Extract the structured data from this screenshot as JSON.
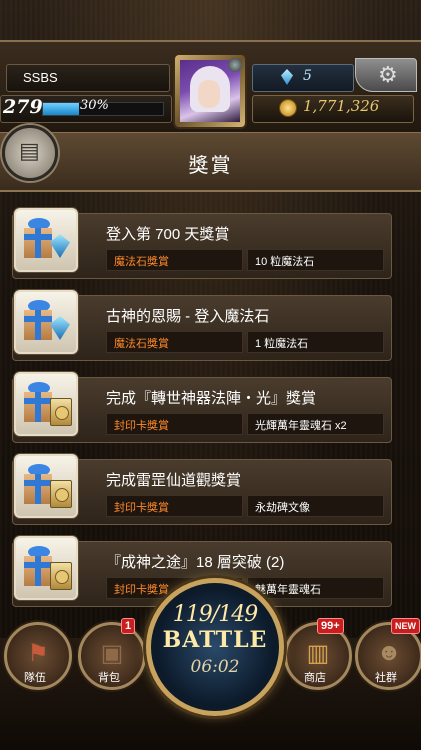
{
  "player": {
    "name": "SSBS",
    "level": "279",
    "xp_percent": "30%",
    "xp_fraction": 0.3
  },
  "currency": {
    "magic_stones": "5",
    "coins": "1,771,326"
  },
  "header": {
    "title": "獎賞"
  },
  "rewards": [
    {
      "title": "登入第 700 天獎賞",
      "type": "魔法石獎賞",
      "item": "10 粒魔法石",
      "icon": "gift-with-magic-stone-icon"
    },
    {
      "title": "古神的恩賜 - 登入魔法石",
      "type": "魔法石獎賞",
      "item": "1 粒魔法石",
      "icon": "gift-with-magic-stone-icon"
    },
    {
      "title": "完成『轉世神器法陣‧光』獎賞",
      "type": "封印卡獎賞",
      "item": "光輝萬年靈魂石 x2",
      "icon": "gift-with-seal-card-icon"
    },
    {
      "title": "完成雷罡仙道觀獎賞",
      "type": "封印卡獎賞",
      "item": "永劫碑文像",
      "icon": "gift-with-seal-card-icon"
    },
    {
      "title": "『成神之途』18 層突破 (2)",
      "type": "封印卡獎賞",
      "item": "魅萬年靈魂石",
      "icon": "gift-with-seal-card-icon"
    }
  ],
  "nav": {
    "team": {
      "label": "隊伍"
    },
    "bag": {
      "label": "背包",
      "badge": "1"
    },
    "battle": {
      "stamina": "119/149",
      "label": "BATTLE",
      "timer": "06:02"
    },
    "shop": {
      "label": "商店",
      "badge": "99+"
    },
    "social": {
      "label": "社群",
      "badge": "NEW"
    }
  },
  "colors": {
    "reward_type": "#ff8a2a",
    "badge": "#c81e1e",
    "gold": "#e8c770"
  }
}
